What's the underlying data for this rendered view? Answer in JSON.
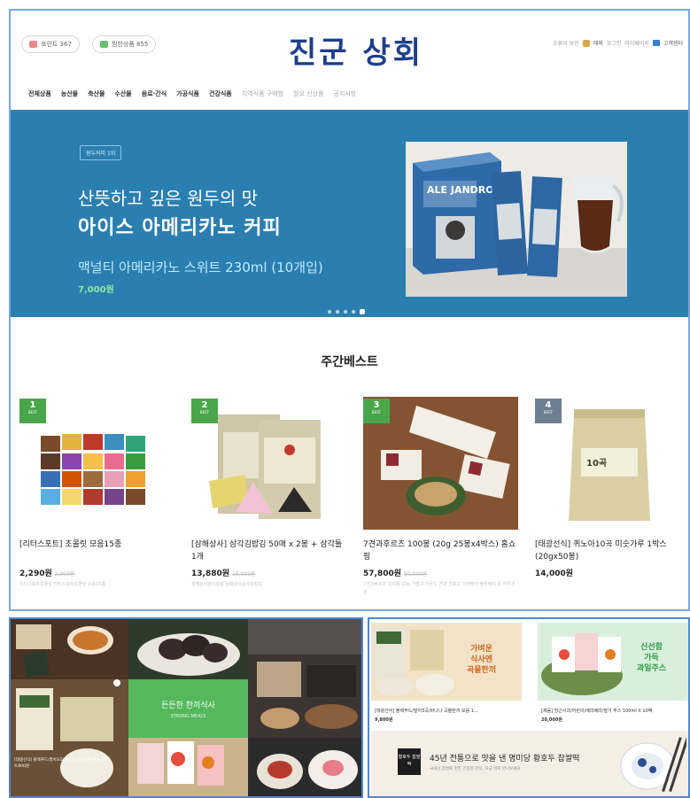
{
  "header": {
    "pill_points": "포인트 367",
    "pill_friends": "찜한상품 855",
    "logo": "진군 상회",
    "util": [
      "오류이 보관",
      "해외",
      "로그인",
      "마이페이지",
      "고객센터"
    ]
  },
  "nav": {
    "items": [
      "전체상품",
      "농산물",
      "축산물",
      "수산물",
      "음료·간식",
      "가공식품",
      "건강식품"
    ],
    "light_items": [
      "지역식품 구매함",
      "월요 신상품",
      "공지사항"
    ]
  },
  "banner": {
    "badge": "원두커피 1위",
    "line1": "산뜻하고 깊은 원두의 맛",
    "line2": "아이스 아메리카노 커피",
    "line3": "맥널티 아메리카노 스위트 230ml (10개입)",
    "price": "7,000원",
    "brand": "ALE JANDRO",
    "dots": [
      0,
      0,
      0,
      0,
      1
    ]
  },
  "best": {
    "title": "주간베스트",
    "products": [
      {
        "rank": "1",
        "rank_label": "BEST",
        "name": "[리터스포트] 초콜릿 모음15종",
        "price": "2,290원",
        "old": "2,900원",
        "desc": "리터스포트초콜릿 리터스포트초콜릿 모음15종"
      },
      {
        "rank": "2",
        "rank_label": "BEST",
        "name": "[삼해상사] 삼각김밥김 50매 x 2봉 + 삼각틀 1개",
        "price": "13,880원",
        "old": "15,000원",
        "desc": "삼해상사삼각김밥 삼해상사삼각김밥김"
      },
      {
        "rank": "3",
        "rank_label": "BEST",
        "name": "7견과후르츠 100봉 (20g 25봉x4박스) 홈쇼핑",
        "price": "57,800원",
        "old": "89,000원",
        "desc": "7견과후르츠 100봉 20g 가볍고 아몬드 견과 건포도 크랜베리 블루베리 등 하루견과"
      },
      {
        "rank": "4",
        "rank_label": "BEST",
        "name": "[태광선식] 퀴노아10곡 미숫가루 1박스 (20gx50봉)",
        "price": "14,000원",
        "old": "",
        "desc": ""
      }
    ]
  },
  "collage": {
    "green_title": "든든한 한끼식사",
    "green_sub": "STRONG MEALS",
    "caption": "[태광선식] 블랙푸드/발아3곡/바나나 곡물한끼 모음 1박스",
    "caption_price": "9,800원"
  },
  "right": {
    "cards": [
      {
        "overlay1": "가벼운",
        "overlay2": "식사엔",
        "overlay3": "곡물한끼",
        "name": "[태광선식] 블랙푸드/발아3곡/바나나 곡물한끼 모음 1...",
        "price": "9,800원"
      },
      {
        "overlay1": "신선함",
        "overlay2": "가득",
        "overlay3": "과일주스",
        "name": "[제움] 당근사과/어린이/베리베리/딸기 주스 100ml X 10팩",
        "price": "20,000원"
      }
    ],
    "banner_logo": "황호두 찹쌀떡",
    "banner_l1": "45년 전통으로 맛을 낸 명미당 황호두 찹쌀떡",
    "banner_l2": "국내산 찹쌀로 만든 건강한 간식, 지금 바로 만나보세요"
  },
  "colors": {
    "banner": "#2b7fb0",
    "logo": "#1e3f8a",
    "rank_green": "#4aa64a",
    "rank_gray": "#6e7f93",
    "price_green": "#8ee6a2"
  }
}
